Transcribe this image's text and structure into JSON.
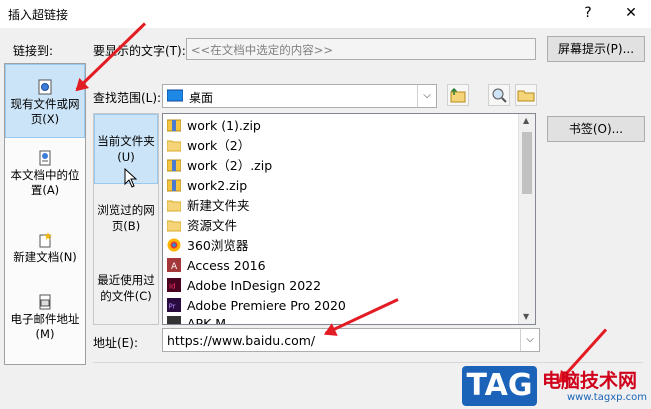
{
  "window": {
    "title": "插入超链接",
    "help_label": "?",
    "close_label": "✕"
  },
  "link_to": {
    "label": "链接到:",
    "items": [
      {
        "label": "现有文件或网页(X)",
        "icon": "web-page-icon"
      },
      {
        "label": "本文档中的位置(A)",
        "icon": "document-place-icon"
      },
      {
        "label": "新建文档(N)",
        "icon": "new-document-icon"
      },
      {
        "label": "电子邮件地址(M)",
        "icon": "email-icon"
      }
    ]
  },
  "display_text": {
    "label": "要显示的文字(T):",
    "value": "<<在文档中选定的内容>>"
  },
  "screen_tip_button": "屏幕提示(P)...",
  "look_in": {
    "label": "查找范围(L):",
    "value": "桌面"
  },
  "bookmark_button": "书签(O)...",
  "browse": {
    "items": [
      "当前文件夹(U)",
      "浏览过的网页(B)",
      "最近使用过的文件(C)"
    ]
  },
  "files": [
    {
      "name": "work (1).zip",
      "icon": "zip-icon"
    },
    {
      "name": "work（2）",
      "icon": "folder-icon"
    },
    {
      "name": "work（2）.zip",
      "icon": "zip-icon"
    },
    {
      "name": "work2.zip",
      "icon": "zip-icon"
    },
    {
      "name": "新建文件夹",
      "icon": "folder-icon"
    },
    {
      "name": "资源文件",
      "icon": "folder-icon"
    },
    {
      "name": "360浏览器",
      "icon": "browser-icon"
    },
    {
      "name": "Access 2016",
      "icon": "access-icon"
    },
    {
      "name": "Adobe InDesign 2022",
      "icon": "indesign-icon"
    },
    {
      "name": "Adobe Premiere Pro 2020",
      "icon": "premiere-icon"
    },
    {
      "name": "APK M...",
      "icon": "app-icon"
    }
  ],
  "address": {
    "label": "地址(E):",
    "value": "https://www.baidu.com/"
  },
  "watermark": {
    "logo": "TAG",
    "site_name": "电脑技术网",
    "url": "www.tagxp.com"
  },
  "colors": {
    "accent": "#e31b23",
    "selection": "#cce4f7",
    "tag_blue": "#1a63b8"
  }
}
